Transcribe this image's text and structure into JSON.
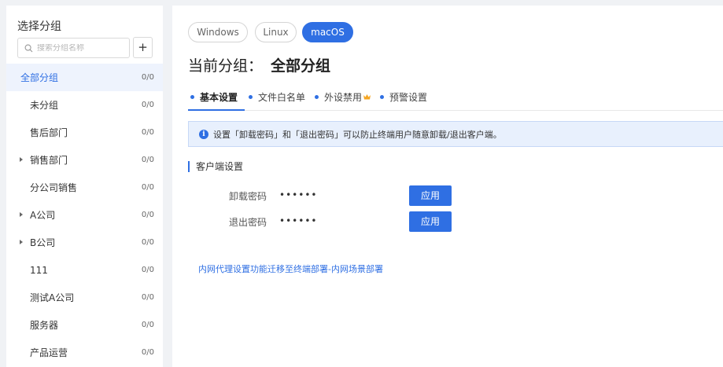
{
  "sidebar": {
    "title": "选择分组",
    "search_placeholder": "搜索分组名称",
    "add_label": "+",
    "groups": [
      {
        "label": "全部分组",
        "count": "0/0",
        "active": true,
        "expandable": false
      },
      {
        "label": "未分组",
        "count": "0/0",
        "active": false,
        "expandable": false
      },
      {
        "label": "售后部门",
        "count": "0/0",
        "active": false,
        "expandable": false
      },
      {
        "label": "销售部门",
        "count": "0/0",
        "active": false,
        "expandable": true
      },
      {
        "label": "分公司销售",
        "count": "0/0",
        "active": false,
        "expandable": false
      },
      {
        "label": "A公司",
        "count": "0/0",
        "active": false,
        "expandable": true
      },
      {
        "label": "B公司",
        "count": "0/0",
        "active": false,
        "expandable": true
      },
      {
        "label": "111",
        "count": "0/0",
        "active": false,
        "expandable": false
      },
      {
        "label": "测试A公司",
        "count": "0/0",
        "active": false,
        "expandable": false
      },
      {
        "label": "服务器",
        "count": "0/0",
        "active": false,
        "expandable": false
      },
      {
        "label": "产品运营",
        "count": "0/0",
        "active": false,
        "expandable": false
      }
    ]
  },
  "os_tabs": [
    {
      "label": "Windows",
      "active": false
    },
    {
      "label": "Linux",
      "active": false
    },
    {
      "label": "macOS",
      "active": true
    }
  ],
  "heading": {
    "prefix": "当前分组：",
    "group_name": "全部分组"
  },
  "settings_tabs": [
    {
      "label": "基本设置",
      "active": true
    },
    {
      "label": "文件白名单",
      "active": false
    },
    {
      "label": "外设禁用",
      "active": false,
      "badge": "crown-icon"
    },
    {
      "label": "预警设置",
      "active": false
    }
  ],
  "info": {
    "text": "设置「卸载密码」和「退出密码」可以防止终端用户随意卸载/退出客户端。"
  },
  "client_settings": {
    "title": "客户端设置",
    "fields": [
      {
        "label": "卸载密码",
        "value": "••••••",
        "button": "应用"
      },
      {
        "label": "退出密码",
        "value": "••••••",
        "button": "应用"
      }
    ]
  },
  "migrate_link": "内网代理设置功能迁移至终端部署-内网场景部署",
  "colors": {
    "accent": "#2f6fe3",
    "active_bg": "#eef3fd",
    "info_bg": "#e8f0fd",
    "badge": "#f5a623"
  }
}
